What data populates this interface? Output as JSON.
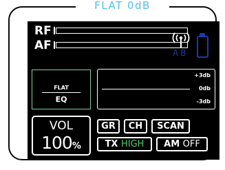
{
  "frame": {
    "title": "FLAT 0dB"
  },
  "meters": {
    "rf": {
      "label": "RF",
      "level": 0.0
    },
    "af": {
      "label": "AF",
      "level": 0.0
    }
  },
  "status": {
    "antenna_icon": "antenna-signal-icon",
    "diversity_a": "A",
    "diversity_b": "B",
    "battery_icon": "battery-icon"
  },
  "eq": {
    "mode": "FLAT",
    "label": "EQ"
  },
  "gain_scale": {
    "labels": [
      "+3db",
      "0db",
      "-3db"
    ]
  },
  "volume": {
    "label": "VOL",
    "value": "100",
    "unit": "%"
  },
  "buttons": {
    "gr": "GR",
    "ch": "CH",
    "scan": "SCAN",
    "tx_prefix": "TX",
    "tx_value": "HIGH",
    "am_prefix": "AM",
    "am_value": "OFF"
  },
  "colors": {
    "title": "#55bde6",
    "screen": "#000000",
    "accent_green": "#4ccd6a",
    "eq_border": "#7bd4a8",
    "status_blue": "#1e3aa8"
  }
}
